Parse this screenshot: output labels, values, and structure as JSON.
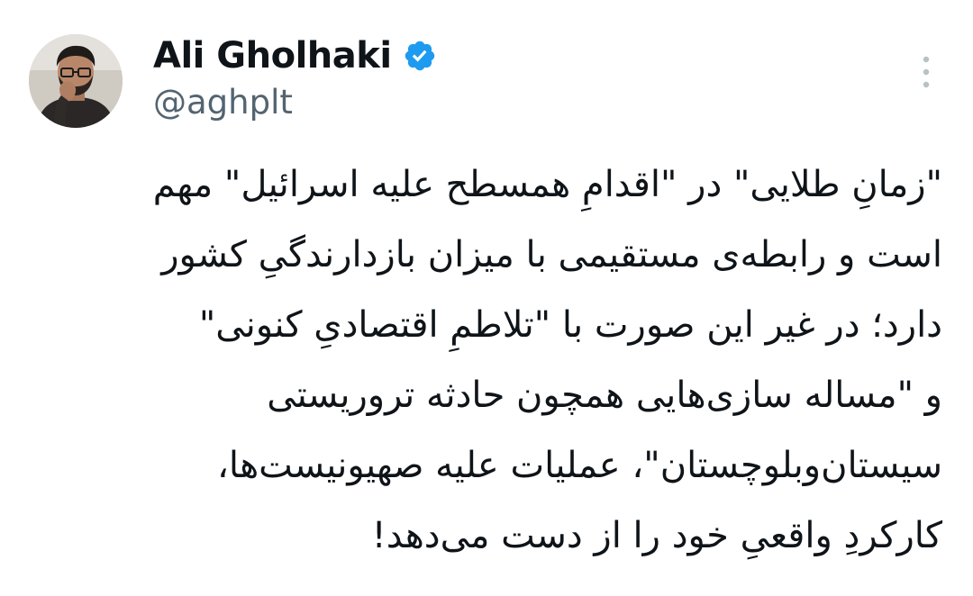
{
  "author": {
    "display_name": "Ali Gholhaki",
    "handle": "@aghplt",
    "verified": true,
    "avatar_icon": "profile-photo",
    "verified_icon": "verified-badge-icon",
    "verified_color": "#1d9bf0"
  },
  "menu": {
    "icon": "more-vertical-icon"
  },
  "tweet": {
    "lines": [
      "\"زمانِ طلایی\" در \"اقدامِ همسطح علیه اسرائیل\" مهم",
      "است و رابطه‌ی مستقیمی با میزان بازدارندگیِ کشور",
      "دارد؛ در غیر این صورت با \"تلاطمِ اقتصادیِ کنونی\"",
      "و \"مساله سازی‌هایی همچون حادثه تروریستی",
      "سیستان‌وبلوچستان\"، عملیات علیه صهیونیست‌ها،",
      "کارکردِ واقعیِ خود را از دست می‌دهد!"
    ]
  },
  "colors": {
    "text": "#0f1419",
    "secondary": "#536471",
    "background": "#ffffff"
  }
}
